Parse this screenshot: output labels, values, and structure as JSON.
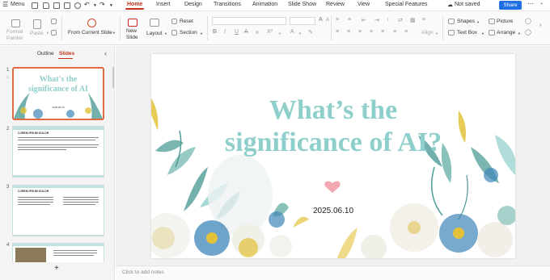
{
  "topbar": {
    "menu_label": "Menu",
    "tabs": [
      {
        "label": "Home",
        "active": true
      },
      {
        "label": "Insert"
      },
      {
        "label": "Design"
      },
      {
        "label": "Transitions"
      },
      {
        "label": "Animation"
      },
      {
        "label": "Slide Show"
      },
      {
        "label": "Review"
      },
      {
        "label": "View"
      },
      {
        "label": "Special Features"
      }
    ],
    "save_status": "Not saved",
    "share_label": "Share",
    "more_icon": "ellipsis-icon"
  },
  "ribbon": {
    "format_painter_label": "Format\nPainter",
    "paste_label": "Paste",
    "from_current_slide_label": "From Current Slide",
    "new_slide_label": "New\nSlide",
    "layout_label": "Layout",
    "reset_label": "Reset",
    "section_label": "Section",
    "align_label": "Align",
    "shapes_label": "Shapes",
    "picture_label": "Picture",
    "text_box_label": "Text Box",
    "arrange_label": "Arrange"
  },
  "left_panel": {
    "tabs": [
      {
        "label": "Outline",
        "active": false
      },
      {
        "label": "Slides",
        "active": true
      }
    ],
    "slides": [
      {
        "number": "1",
        "title_line1": "What's the",
        "title_line2": "significance of AI",
        "date": "2025.06.10"
      },
      {
        "number": "2",
        "heading": "LOREM IPSUM DOLOR"
      },
      {
        "number": "3",
        "heading": "LOREM IPSUM DOLOR"
      },
      {
        "number": "4",
        "heading": ""
      }
    ],
    "add_slide_symbol": "+"
  },
  "slide": {
    "title_line1": "What’s the",
    "title_line2": "significance of AI?",
    "date": "2025.06.10",
    "colors": {
      "title": "#8fcfcb",
      "heart": "#f2a7b1",
      "teal_leaf": "#4e9c98",
      "blue_flower": "#3f86b8",
      "yellow": "#e3c23a"
    }
  },
  "notes": {
    "placeholder": "Click to add notes"
  }
}
